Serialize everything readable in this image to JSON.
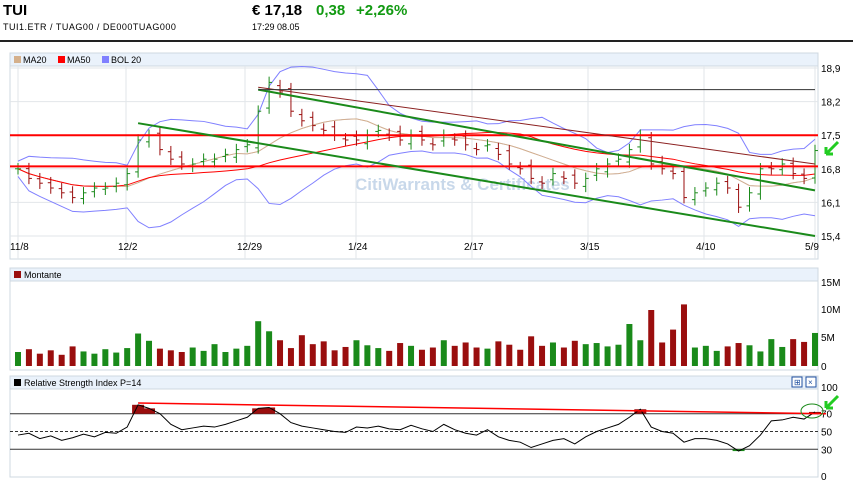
{
  "header": {
    "title": "TUI",
    "ids": "TUI1.ETR   /   TUAG00   /   DE000TUAG000",
    "price": "€ 17,18",
    "change": "0,38",
    "change_pct": "+2,26%",
    "time": "17:29   08.05"
  },
  "colors": {
    "up": "#1a8a1a",
    "down": "#9a0e0e",
    "ma20": "#d4b08c",
    "ma50": "#ff0000",
    "bol": "#8080ff",
    "positive": "#129a12"
  },
  "panels": {
    "price_legend": [
      "MA20",
      "MA50",
      "BOL 20"
    ],
    "volume_legend": "Montante",
    "rsi_legend": "Relative Strength Index P=14",
    "watermark": "CitiWarrants & Certificates"
  },
  "chart_data": [
    {
      "type": "candlestick",
      "x_ticks": [
        "11/8",
        "12/2",
        "12/29",
        "1/24",
        "2/17",
        "3/15",
        "4/10",
        "5/9"
      ],
      "y_ticks": [
        "18,9",
        "18,2",
        "17,5",
        "16,8",
        "16,1",
        "15,4"
      ],
      "ylim": [
        15.4,
        18.9
      ],
      "grid": true,
      "closes": [
        16.8,
        16.6,
        16.5,
        16.4,
        16.3,
        16.2,
        16.3,
        16.4,
        16.4,
        16.5,
        16.7,
        17.4,
        17.5,
        17.2,
        17.0,
        16.9,
        16.9,
        17.0,
        17.0,
        17.1,
        17.2,
        17.3,
        18.0,
        18.6,
        18.4,
        18.0,
        17.8,
        17.7,
        17.6,
        17.5,
        17.4,
        17.4,
        17.5,
        17.6,
        17.5,
        17.4,
        17.5,
        17.4,
        17.3,
        17.5,
        17.4,
        17.3,
        17.2,
        17.3,
        17.1,
        16.9,
        16.8,
        16.6,
        16.5,
        16.7,
        16.6,
        16.5,
        16.6,
        16.8,
        16.9,
        17.0,
        17.2,
        17.5,
        16.9,
        16.8,
        16.7,
        16.2,
        16.3,
        16.4,
        16.5,
        16.4,
        16.0,
        16.3,
        16.8,
        16.8,
        16.9,
        16.7,
        16.6,
        17.18
      ],
      "horizontal_lines": [
        17.5,
        16.85
      ],
      "trendlines": [
        {
          "color": "#1a8a1a",
          "from": [
            11,
            17.75
          ],
          "to": [
            73,
            15.4
          ]
        },
        {
          "color": "#1a8a1a",
          "from": [
            22,
            18.45
          ],
          "to": [
            73,
            16.35
          ]
        },
        {
          "color": "#8b2020",
          "from": [
            22,
            18.5
          ],
          "to": [
            73,
            16.9
          ]
        },
        {
          "color": "#333333",
          "from": [
            22,
            18.45
          ],
          "to": [
            73,
            18.45
          ]
        }
      ]
    },
    {
      "type": "bar",
      "name": "Montante",
      "y_ticks": [
        "15M",
        "10M",
        "5M",
        "0"
      ],
      "ylim": [
        0,
        15
      ],
      "values": [
        2.5,
        3,
        2.2,
        2.8,
        2,
        3.5,
        2.6,
        2.2,
        3,
        2.4,
        3.2,
        5.8,
        4.5,
        3.1,
        2.8,
        2.5,
        3.3,
        2.7,
        3.9,
        2.5,
        3.1,
        3.6,
        8,
        6.2,
        4.6,
        3.2,
        5.5,
        3.9,
        4.4,
        2.8,
        3.4,
        4.6,
        3.7,
        3.2,
        2.7,
        4.1,
        3.6,
        2.9,
        3.3,
        4.6,
        3.6,
        4.2,
        3.3,
        3.1,
        4.4,
        3.8,
        2.9,
        5.3,
        3.6,
        4.2,
        3.3,
        4.5,
        3.9,
        4.1,
        3.5,
        3.8,
        7.5,
        4.6,
        10,
        4.2,
        6.5,
        11,
        3.3,
        3.6,
        2.7,
        3.5,
        4.1,
        3.7,
        2.6,
        4.8,
        3.4,
        4.8,
        4.3,
        5.9
      ]
    },
    {
      "type": "line",
      "name": "Relative Strength Index P=14",
      "y_ticks": [
        "100",
        "70",
        "50",
        "30",
        "0"
      ],
      "ylim": [
        0,
        100
      ],
      "reference_lines": [
        70,
        50,
        30
      ],
      "values": [
        46,
        48,
        42,
        45,
        40,
        43,
        47,
        44,
        49,
        48,
        55,
        80,
        76,
        70,
        58,
        52,
        54,
        56,
        55,
        58,
        62,
        66,
        76,
        77,
        70,
        60,
        56,
        54,
        52,
        50,
        49,
        55,
        54,
        56,
        53,
        52,
        57,
        53,
        50,
        58,
        52,
        48,
        46,
        52,
        44,
        40,
        38,
        32,
        36,
        40,
        42,
        36,
        44,
        50,
        54,
        58,
        66,
        75,
        55,
        50,
        48,
        38,
        42,
        42,
        40,
        36,
        28,
        34,
        46,
        62,
        63,
        66,
        64,
        72
      ]
    }
  ]
}
